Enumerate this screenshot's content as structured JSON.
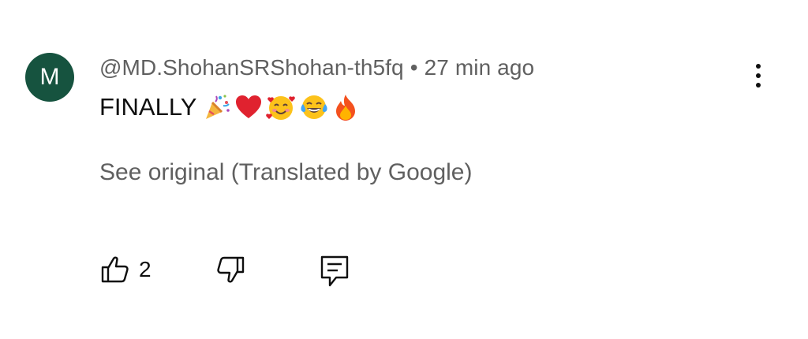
{
  "comment": {
    "avatar_letter": "M",
    "avatar_color": "#16533f",
    "author": "@MD.ShohanSRShohan-th5fq",
    "separator": "•",
    "time": "27 min ago",
    "text": "FINALLY",
    "emojis": [
      "party-popper-icon",
      "red-heart-icon",
      "smiling-face-with-hearts-icon",
      "tears-of-joy-icon",
      "fire-icon"
    ],
    "see_original": "See original (Translated by Google)",
    "like_count": "2"
  },
  "icons": {
    "menu": "more-vert-icon",
    "like": "thumbs-up-icon",
    "dislike": "thumbs-down-icon",
    "reply": "reply-comment-icon"
  }
}
